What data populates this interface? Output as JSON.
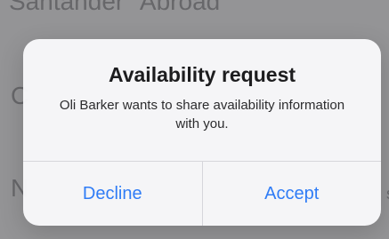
{
  "background": {
    "top_text": "Santander \"Abroad\"",
    "left_letters": [
      "C",
      "N"
    ],
    "right_fragment": "s"
  },
  "alert": {
    "title": "Availability request",
    "message": "Oli Barker wants to share availability information with you.",
    "buttons": {
      "decline": "Decline",
      "accept": "Accept"
    }
  },
  "colors": {
    "accent": "#2f7cf6",
    "alert_background": "#f8f8fa",
    "overlay": "#a9a9ab"
  }
}
